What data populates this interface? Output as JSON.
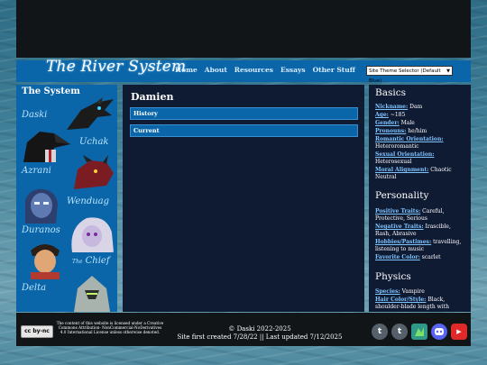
{
  "site": {
    "logo": "The River System"
  },
  "nav": {
    "links": [
      "Home",
      "About",
      "Resources",
      "Essays",
      "Other Stuff"
    ],
    "theme_selector": "Site Theme Selector (Default Blue)"
  },
  "sidebar": {
    "title": "The System",
    "members": [
      "Daski",
      "Uchak",
      "Azrani",
      "Wenduag",
      "Duranos",
      "Chief",
      "Delta"
    ],
    "chief_prefix": "The"
  },
  "main": {
    "title": "Damien",
    "sections": [
      "History",
      "Current"
    ]
  },
  "profile": {
    "basics_title": "Basics",
    "basics": [
      {
        "k": "Nickname:",
        "v": "Dam"
      },
      {
        "k": "Age:",
        "v": "~185"
      },
      {
        "k": "Gender:",
        "v": "Male"
      },
      {
        "k": "Pronouns:",
        "v": "he/him"
      },
      {
        "k": "Romantic Orientation:",
        "v": "Heteroromantic"
      },
      {
        "k": "Sexual Orientation:",
        "v": "Heterosexual"
      },
      {
        "k": "Moral Alignment:",
        "v": "Chaotic Neutral"
      }
    ],
    "personality_title": "Personality",
    "personality": [
      {
        "k": "Positive Traits:",
        "v": "Careful, Protective, Serious"
      },
      {
        "k": "Negative Traits:",
        "v": "Irascible, Rash, Abrasive"
      },
      {
        "k": "Hobbies/Pastimes:",
        "v": "travelling, listening to music"
      },
      {
        "k": "Favorite Color:",
        "v": "scarlet"
      }
    ],
    "physics_title": "Physics",
    "physics": [
      {
        "k": "Species:",
        "v": "Vampire"
      },
      {
        "k": "Hair Color/Style:",
        "v": "Black, shoulder-blade length with"
      }
    ]
  },
  "footer": {
    "cc_badge": "cc by-nc",
    "license_parts": [
      "The content of this website is licensed under a Creative Commons Attribution-",
      "NonCommercial-NoDerivatives 4.0",
      "International License",
      "unless otherwise denoted."
    ],
    "copyright": "© Daski 2022-2025",
    "dates": "Site first created 7/28/22 || Last updated 7/12/2025",
    "socials": [
      {
        "icon": "tumblr-icon",
        "glyph": "t",
        "color": "#55606b"
      },
      {
        "icon": "tumblr-icon",
        "glyph": "t",
        "color": "#55606b"
      },
      {
        "icon": "bluesky-icon",
        "glyph": "",
        "color": "#2f9a8a"
      },
      {
        "icon": "discord-icon",
        "glyph": "●",
        "color": "#5865f2"
      },
      {
        "icon": "youtube-icon",
        "glyph": "▶",
        "color": "#e02a2a"
      }
    ]
  }
}
